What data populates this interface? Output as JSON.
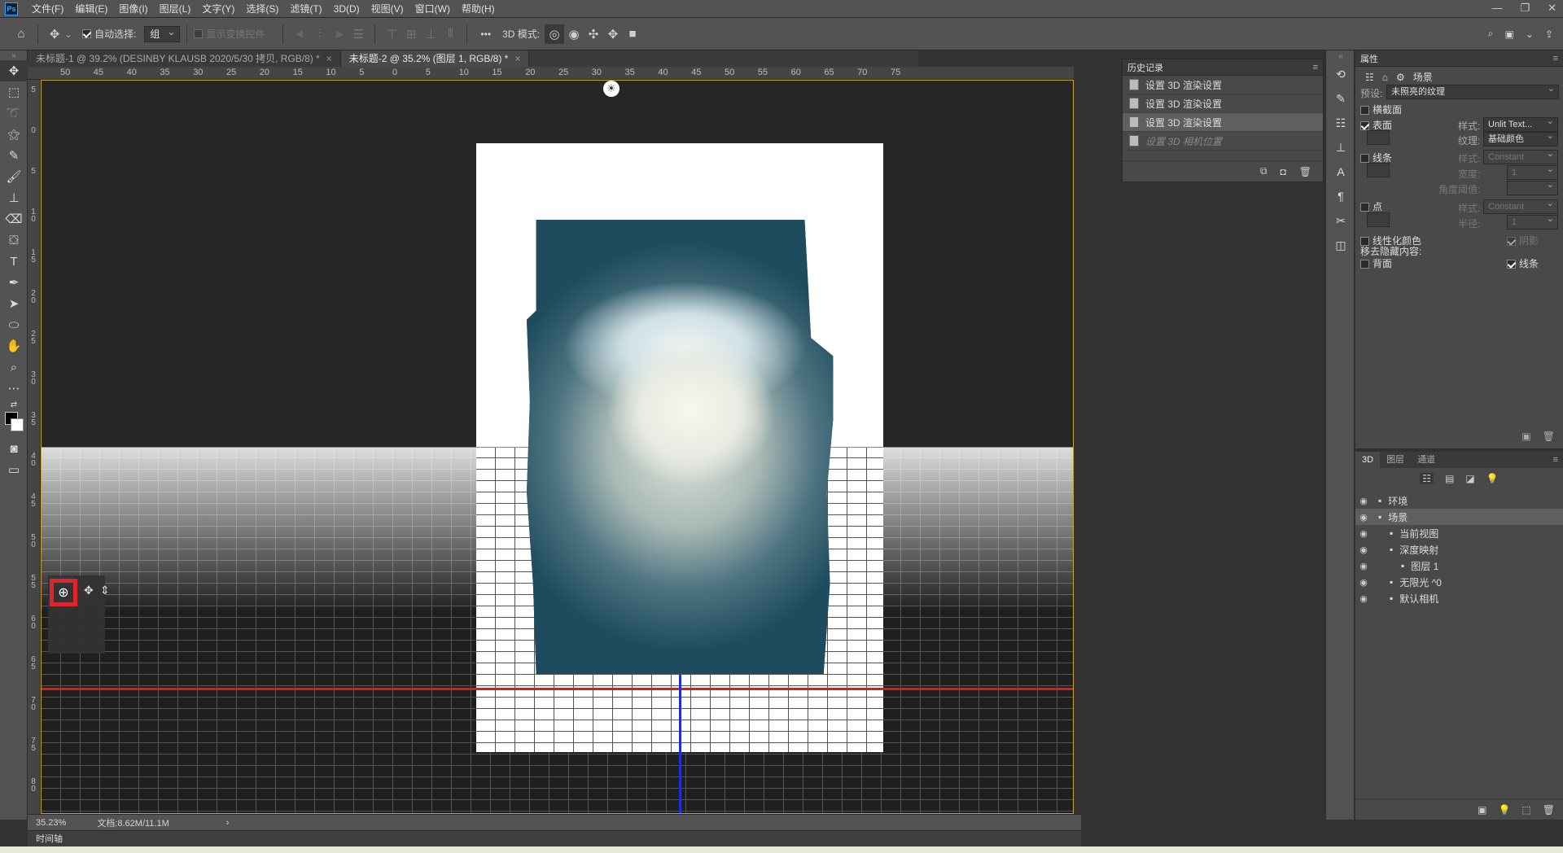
{
  "app": {
    "logo": "Ps"
  },
  "menu": [
    "文件(F)",
    "编辑(E)",
    "图像(I)",
    "图层(L)",
    "文字(Y)",
    "选择(S)",
    "滤镜(T)",
    "3D(D)",
    "视图(V)",
    "窗口(W)",
    "帮助(H)"
  ],
  "window_controls": {
    "minimize": "—",
    "restore": "❐",
    "close": "✕"
  },
  "options": {
    "auto_select_label": "自动选择:",
    "auto_select_value": "组",
    "show_transform_label": "显示变换控件",
    "mode_3d_label": "3D 模式:",
    "more": "•••"
  },
  "tabs": [
    {
      "label": "未标题-1 @ 39.2% (DESINBY KLAUSB    2020/5/30 拷贝, RGB/8) *",
      "close": "×"
    },
    {
      "label": "未标题-2 @ 35.2% (图层 1, RGB/8) *",
      "close": "×"
    }
  ],
  "ruler_top": [
    "50",
    "45",
    "40",
    "35",
    "30",
    "25",
    "20",
    "15",
    "10",
    "5",
    "0",
    "5",
    "10",
    "15",
    "20",
    "25",
    "30",
    "35",
    "40",
    "45",
    "50",
    "55",
    "60",
    "65",
    "70",
    "75"
  ],
  "ruler_left": [
    "5",
    "0",
    "5",
    "1\n0",
    "1\n5",
    "2\n0",
    "2\n5",
    "3\n0",
    "3\n5",
    "4\n0",
    "4\n5",
    "5\n0",
    "5\n5",
    "6\n0",
    "6\n5",
    "7\n0",
    "7\n5",
    "8\n0"
  ],
  "history": {
    "title": "历史记录",
    "items": [
      {
        "label": "设置 3D 渲染设置",
        "state": "normal"
      },
      {
        "label": "设置 3D 渲染设置",
        "state": "normal"
      },
      {
        "label": "设置 3D 渲染设置",
        "state": "selected"
      },
      {
        "label": "设置 3D 相机位置",
        "state": "ghost"
      }
    ]
  },
  "properties": {
    "title": "属性",
    "section": "场景",
    "preset_label": "预设:",
    "preset_value": "未照亮的纹理",
    "cross_section": "横截面",
    "surface": "表面",
    "style_label": "样式:",
    "surface_style": "Unlit Text...",
    "texture_label": "纹理:",
    "texture_value": "基础颜色",
    "lines": "线条",
    "lines_style": "Constant",
    "width_label": "宽度:",
    "width_value": "1",
    "angle_label": "角度阈值:",
    "points": "点",
    "points_style": "Constant",
    "radius_label": "半径:",
    "radius_value": "1",
    "linearize": "线性化颜色",
    "shadow": "阴影",
    "remove_hidden": "移去隐藏内容:",
    "back_face": "背面",
    "lines_check": "线条"
  },
  "panel3d": {
    "tabs": [
      "3D",
      "图层",
      "通道"
    ],
    "tree": [
      {
        "label": "环境",
        "indent": 0
      },
      {
        "label": "场景",
        "indent": 0,
        "selected": true
      },
      {
        "label": "当前视图",
        "indent": 1
      },
      {
        "label": "深度映射",
        "indent": 1
      },
      {
        "label": "图层 1",
        "indent": 2
      },
      {
        "label": "无限光 ^0",
        "indent": 1
      },
      {
        "label": "默认相机",
        "indent": 1
      }
    ]
  },
  "status": {
    "zoom": "35.23%",
    "doc": "文档:8.62M/11.1M",
    "arrow": "›"
  },
  "timeline": "时间轴",
  "icons": {
    "home": "⌂",
    "move": "✥",
    "light": "☀"
  }
}
